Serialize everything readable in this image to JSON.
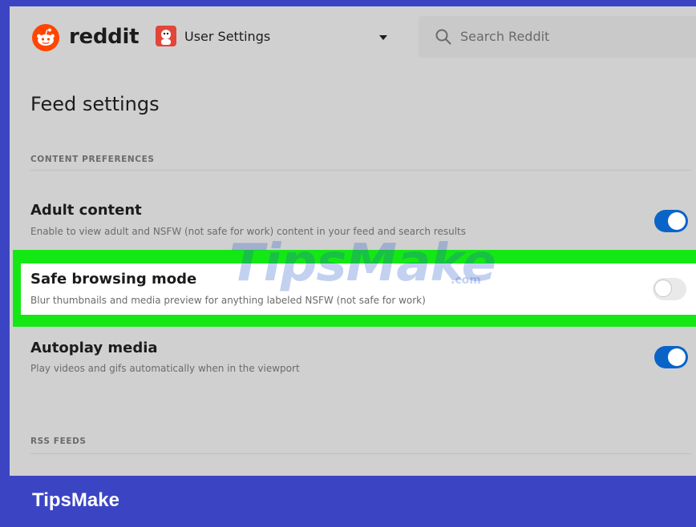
{
  "header": {
    "brand": "reddit",
    "logo_icon": "reddit-alien-icon",
    "community_icon": "user-avatar-icon",
    "community_label": "User Settings",
    "dropdown_icon": "caret-down-icon",
    "search": {
      "icon": "search-icon",
      "placeholder": "Search Reddit"
    }
  },
  "page": {
    "title": "Feed settings",
    "sections": [
      {
        "label": "CONTENT PREFERENCES",
        "items": [
          {
            "title": "Adult content",
            "description": "Enable to view adult and NSFW (not safe for work) content in your feed and search results",
            "enabled": true
          },
          {
            "title": "Safe browsing mode",
            "description": "Blur thumbnails and media preview for anything labeled NSFW (not safe for work)",
            "enabled": false
          },
          {
            "title": "Autoplay media",
            "description": "Play videos and gifs automatically when in the viewport",
            "enabled": true
          }
        ]
      },
      {
        "label": "RSS FEEDS"
      }
    ]
  },
  "watermark": {
    "text": "TipsMake",
    "suffix": ".com"
  },
  "banner": {
    "text": "TipsMake"
  },
  "colors": {
    "toggle_on": "#0a64c8",
    "highlight": "#14e814",
    "banner": "#3b45c4",
    "brand_orange": "#ff4500"
  }
}
